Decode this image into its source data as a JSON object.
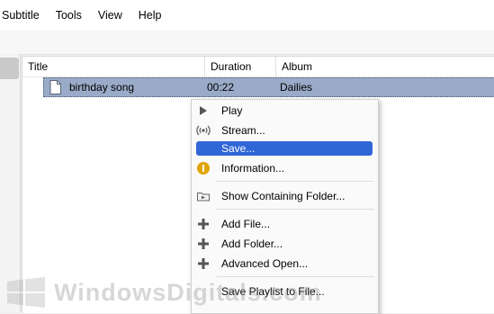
{
  "menubar": {
    "items": [
      "Subtitle",
      "Tools",
      "View",
      "Help"
    ]
  },
  "playlist": {
    "columns": {
      "title": "Title",
      "duration": "Duration",
      "album": "Album"
    },
    "rows": [
      {
        "title": "birthday song",
        "duration": "00:22",
        "album": "Dailies"
      }
    ]
  },
  "context_menu": {
    "items": [
      {
        "label": "Play",
        "icon": "play-icon"
      },
      {
        "label": "Stream...",
        "icon": "stream-icon"
      },
      {
        "label": "Save...",
        "icon": "",
        "highlighted": true
      },
      {
        "label": "Information...",
        "icon": "info-icon"
      },
      {
        "label": "Show Containing Folder...",
        "icon": "folder-icon"
      },
      {
        "label": "Add File...",
        "icon": "plus-icon"
      },
      {
        "label": "Add Folder...",
        "icon": "plus-icon"
      },
      {
        "label": "Advanced Open...",
        "icon": "plus-icon"
      },
      {
        "label": "Save Playlist to File...",
        "icon": ""
      }
    ]
  },
  "watermark": {
    "text": "WindowsDigitals.com"
  },
  "colors": {
    "row_selected": "#99abc8",
    "menu_highlight": "#3066d6",
    "info_icon": "#e0a400"
  }
}
